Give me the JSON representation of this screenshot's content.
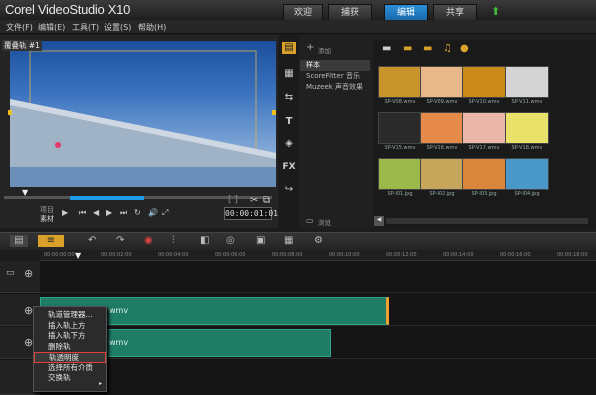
{
  "app": {
    "title": "Corel VideoStudio X10"
  },
  "tabs": [
    "欢迎",
    "捕获",
    "编辑",
    "共享"
  ],
  "active_tab": "编辑",
  "menu": [
    "文件(F)",
    "编辑(E)",
    "工具(T)",
    "设置(S)",
    "帮助(H)"
  ],
  "preview": {
    "track_label": "覆叠轨 #1",
    "project_label": "项目",
    "clip_label": "素材",
    "timecode": "00:00:01:01"
  },
  "library": {
    "add_label": "添加",
    "browse_label": "浏览",
    "categories": [
      "样本",
      "ScoreFitter 音乐",
      "Muzeek 声音效果"
    ],
    "selected_category": "样本",
    "thumbs": [
      {
        "label": "SP-V08.wmv",
        "color": "#c8952a"
      },
      {
        "label": "SP-V09.wmv",
        "color": "#e8b88a"
      },
      {
        "label": "SP-V10.wmv",
        "color": "#c98a17"
      },
      {
        "label": "SP-V11.wmv",
        "color": "#d4d4d4"
      },
      {
        "label": "SP-V15.wmv",
        "color": "#2a2a2a"
      },
      {
        "label": "SP-V16.wmv",
        "color": "#e68a4a"
      },
      {
        "label": "SP-V17.wmv",
        "color": "#e9b6a8"
      },
      {
        "label": "SP-V18.wmv",
        "color": "#e8e26a"
      },
      {
        "label": "SP-I01.jpg",
        "color": "#9bb84a"
      },
      {
        "label": "SP-I02.jpg",
        "color": "#c5a65a"
      },
      {
        "label": "SP-I03.jpg",
        "color": "#d9863a"
      },
      {
        "label": "SP-I04.jpg",
        "color": "#4a98c8"
      }
    ]
  },
  "timeline": {
    "ruler": [
      "00:00:00:00",
      "00:00:02:00",
      "00:00:04:00",
      "00:00:06:00",
      "00:00:08:00",
      "00:00:10:00",
      "00:00:12:00",
      "00:00:14:00",
      "00:00:16:00",
      "00:00:18:00"
    ],
    "clips": [
      {
        "label": "wmv"
      },
      {
        "label": "wmv"
      }
    ]
  },
  "context_menu": {
    "items": [
      "轨道管理器...",
      "插入轨上方",
      "插入轨下方",
      "删除轨",
      "轨透明度",
      "选择所有介质",
      "交换轨"
    ],
    "highlighted": "轨透明度"
  },
  "colors": {
    "accent": "#1e7fcf",
    "clip": "#1f7c65",
    "highlight": "#e0403c"
  }
}
